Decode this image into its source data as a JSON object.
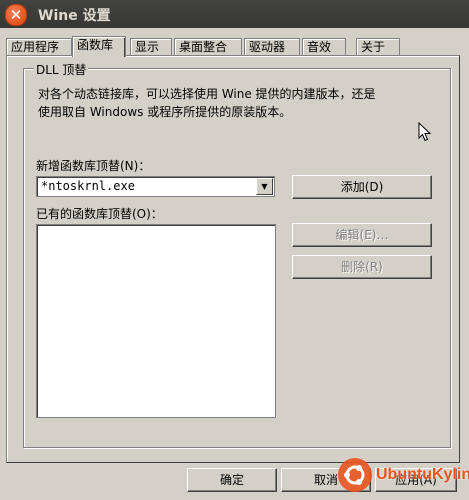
{
  "window": {
    "title": "Wine 设置",
    "close_glyph": "✕"
  },
  "tabs": [
    {
      "label": "应用程序"
    },
    {
      "label": "函数库",
      "active": true
    },
    {
      "label": "显示"
    },
    {
      "label": "桌面整合"
    },
    {
      "label": "驱动器"
    },
    {
      "label": "音效"
    },
    {
      "label": "关于"
    }
  ],
  "group": {
    "title": "DLL 顶替",
    "description_line1": "对各个动态链接库，可以选择使用 Wine 提供的内建版本，还是",
    "description_line2": "使用取自 Windows 或程序所提供的原装版本。"
  },
  "new_override": {
    "label": "新增函数库顶替(N)：",
    "value": "*ntoskrnl.exe",
    "add_button": "添加(D)"
  },
  "existing": {
    "label": "已有的函数库顶替(O)：",
    "items": [],
    "edit_button": "编辑(E)…",
    "remove_button": "删除(R)"
  },
  "footer": {
    "ok_button": "确定",
    "cancel_button": "取消",
    "apply_button": "应用(A)"
  },
  "watermark": {
    "text": "UbuntuKylin"
  },
  "colors": {
    "accent": "#e95420",
    "window_bg": "#d4d0c8",
    "titlebar": "#3c3c38"
  }
}
